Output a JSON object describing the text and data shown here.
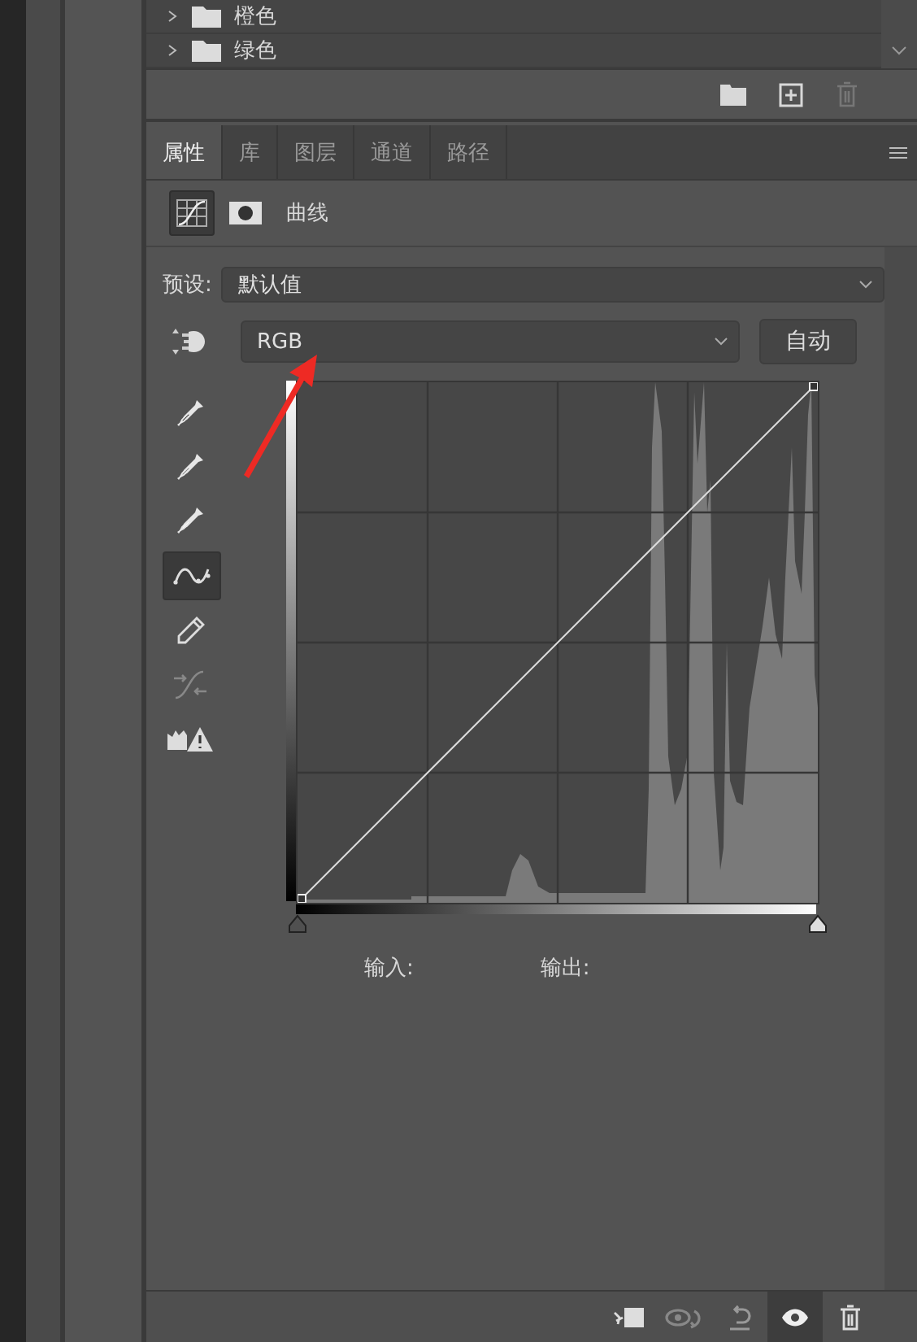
{
  "layers": [
    {
      "name": "橙色",
      "expanded": false
    },
    {
      "name": "绿色",
      "expanded": false
    }
  ],
  "tabs": [
    {
      "label": "属性",
      "selected": true
    },
    {
      "label": "库",
      "selected": false
    },
    {
      "label": "图层",
      "selected": false
    },
    {
      "label": "通道",
      "selected": false
    },
    {
      "label": "路径",
      "selected": false
    }
  ],
  "adjustment": {
    "title": "曲线"
  },
  "preset": {
    "label": "预设:",
    "value": "默认值"
  },
  "channel": {
    "value": "RGB"
  },
  "auto_button": "自动",
  "tools": [
    {
      "kind": "eyedropper-black",
      "selected": false
    },
    {
      "kind": "eyedropper-gray",
      "selected": false
    },
    {
      "kind": "eyedropper-white",
      "selected": false
    },
    {
      "kind": "curve",
      "selected": true
    },
    {
      "kind": "pencil",
      "selected": false
    },
    {
      "kind": "smooth",
      "selected": false
    },
    {
      "kind": "clipping",
      "selected": false
    }
  ],
  "input_sliders": [
    {
      "level": 0
    },
    {
      "level": 1
    }
  ],
  "input_label": "输入:",
  "output_label": "输出:",
  "footer_tools": [
    {
      "kind": "clip",
      "selected": false
    },
    {
      "kind": "view-previous",
      "selected": false
    },
    {
      "kind": "reset",
      "selected": false
    },
    {
      "kind": "visibility",
      "selected": true
    },
    {
      "kind": "delete",
      "selected": false
    }
  ]
}
